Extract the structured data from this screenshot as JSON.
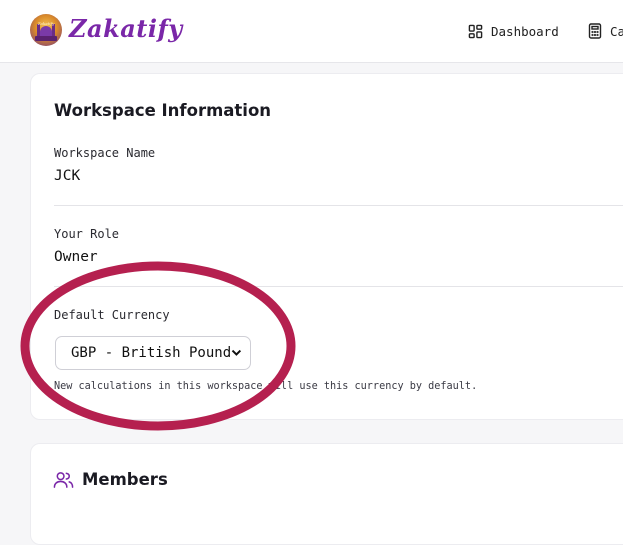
{
  "header": {
    "brand": "Zakatify",
    "brand_badge_text": "Zakatify",
    "nav": [
      {
        "label": "Dashboard",
        "icon": "dashboard-grid-icon"
      },
      {
        "label": "Ca",
        "icon": "calculator-icon"
      }
    ]
  },
  "workspace": {
    "title": "Workspace Information",
    "name_label": "Workspace Name",
    "name_value": "JCK",
    "role_label": "Your Role",
    "role_value": "Owner",
    "currency_label": "Default Currency",
    "currency_value": "GBP - British Pound",
    "currency_helper": "New calculations in this workspace will use this currency by default."
  },
  "members": {
    "title": "Members",
    "icon": "users-icon"
  },
  "colors": {
    "brand": "#7a27a8",
    "annotation": "#b5204f"
  }
}
